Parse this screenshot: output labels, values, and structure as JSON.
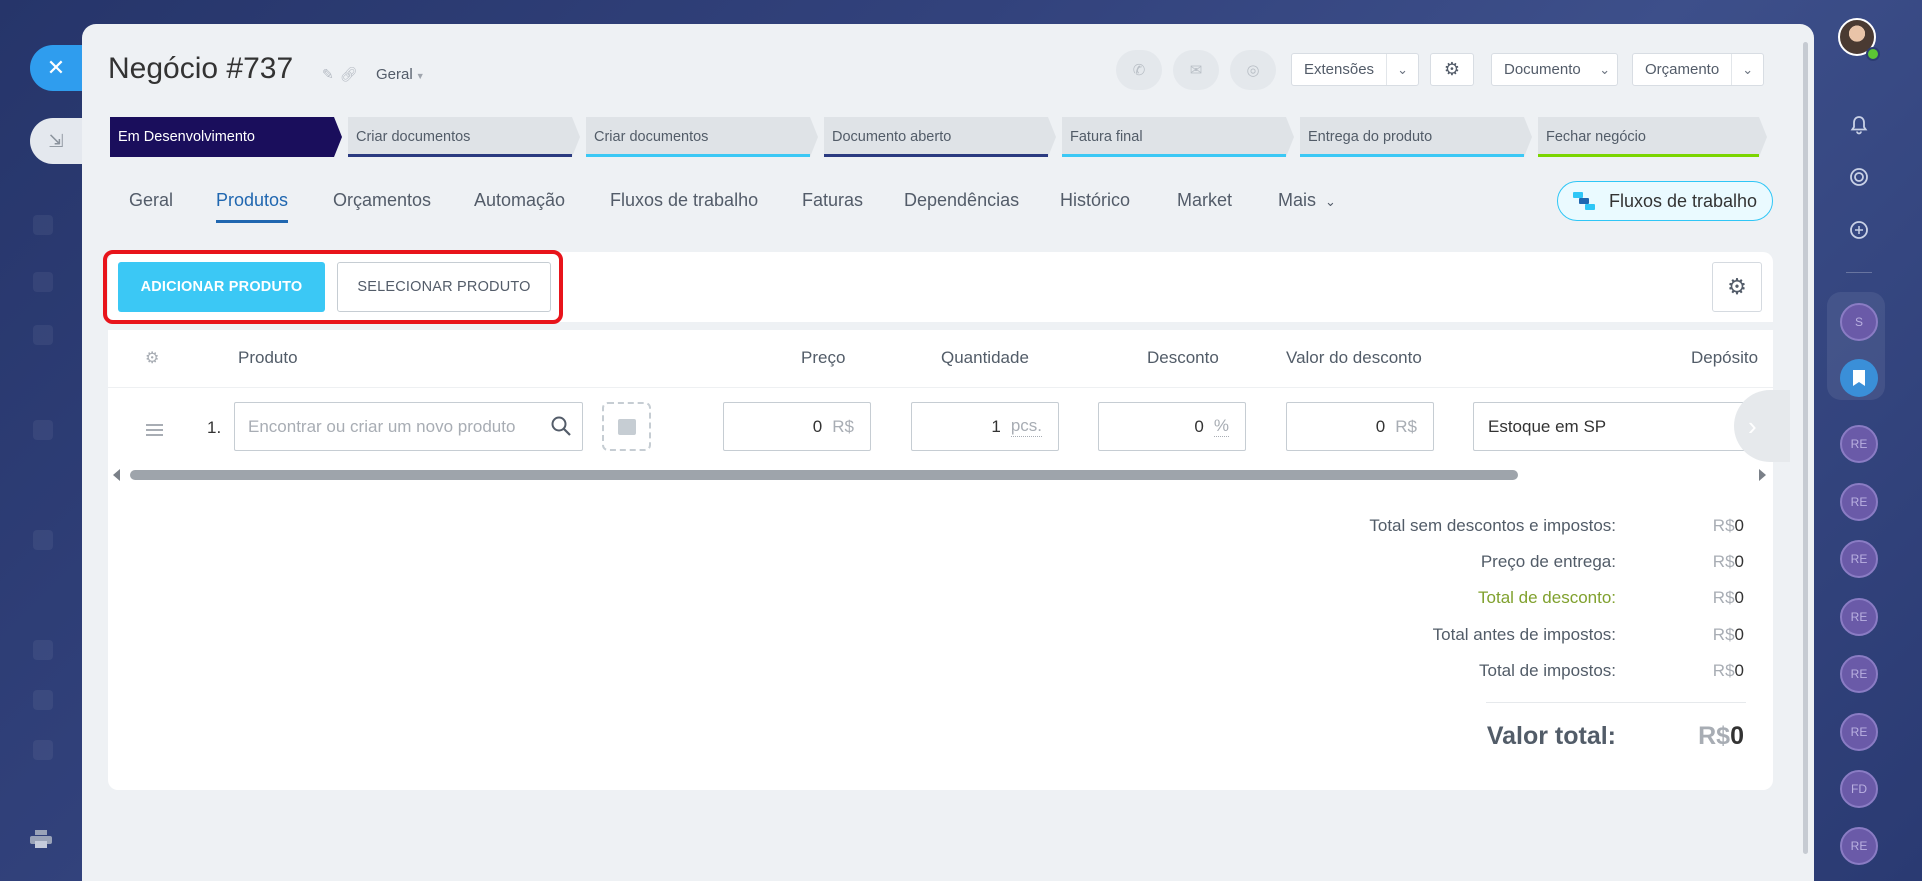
{
  "header": {
    "title": "Negócio #737",
    "pipeline": "Geral",
    "extensions_label": "Extensões",
    "document_label": "Documento",
    "quote_label": "Orçamento"
  },
  "stages": [
    {
      "label": "Em Desenvolvimento",
      "color": "#1a0e5c",
      "active": true
    },
    {
      "label": "Criar documentos",
      "color": "#2a3a80"
    },
    {
      "label": "Criar documentos",
      "color": "#3bc8f5"
    },
    {
      "label": "Documento aberto",
      "color": "#2a3a80"
    },
    {
      "label": "Fatura final",
      "color": "#3bc8f5"
    },
    {
      "label": "Entrega do produto",
      "color": "#3bc8f5"
    },
    {
      "label": "Fechar negócio",
      "color": "#7bd500"
    }
  ],
  "tabs": [
    {
      "label": "Geral"
    },
    {
      "label": "Produtos",
      "selected": true
    },
    {
      "label": "Orçamentos"
    },
    {
      "label": "Automação"
    },
    {
      "label": "Fluxos de trabalho"
    },
    {
      "label": "Faturas"
    },
    {
      "label": "Dependências"
    },
    {
      "label": "Histórico"
    },
    {
      "label": "Market"
    },
    {
      "label": "Mais"
    }
  ],
  "workflows_button": "Fluxos de trabalho",
  "toolbar": {
    "add_product": "ADICIONAR PRODUTO",
    "select_product": "SELECIONAR PRODUTO"
  },
  "table": {
    "columns": {
      "product": "Produto",
      "price": "Preço",
      "quantity": "Quantidade",
      "discount": "Desconto",
      "discount_value": "Valor do desconto",
      "warehouse": "Depósito"
    },
    "rows": [
      {
        "number": "1.",
        "product_placeholder": "Encontrar ou criar um novo produto",
        "price": "0",
        "price_unit": "R$",
        "quantity": "1",
        "quantity_unit": "pcs.",
        "discount": "0",
        "discount_unit": "%",
        "discount_value": "0",
        "discount_value_unit": "R$",
        "warehouse": "Estoque em SP"
      }
    ]
  },
  "totals": [
    {
      "label": "Total sem descontos e impostos:",
      "currency": "R$",
      "value": "0"
    },
    {
      "label": "Preço de entrega:",
      "currency": "R$",
      "value": "0"
    },
    {
      "label": "Total de desconto:",
      "currency": "R$",
      "value": "0",
      "color": "#80a12e"
    },
    {
      "label": "Total antes de impostos:",
      "currency": "R$",
      "value": "0"
    },
    {
      "label": "Total de impostos:",
      "currency": "R$",
      "value": "0"
    }
  ],
  "grand_total": {
    "label": "Valor total:",
    "currency": "R$",
    "value": "0"
  },
  "right_rail": {
    "avatars": [
      "S",
      "RE",
      "RE",
      "RE",
      "RE",
      "RE",
      "RE",
      "FD",
      "RE"
    ]
  },
  "colors": {
    "accent": "#3bc8f5",
    "link": "#2067b0",
    "highlight": "#e8141b"
  }
}
